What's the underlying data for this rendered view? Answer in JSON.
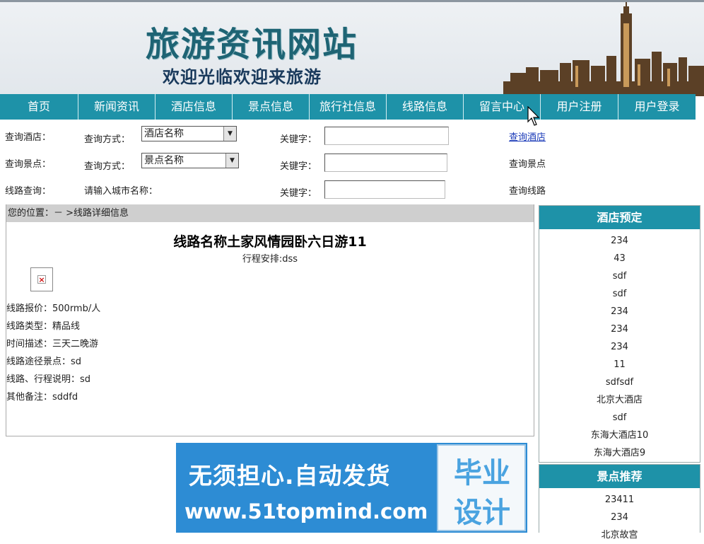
{
  "header": {
    "site_title": "旅游资讯网站",
    "subtitle": "欢迎光临欢迎来旅游"
  },
  "nav": {
    "items": [
      "首页",
      "新闻资讯",
      "酒店信息",
      "景点信息",
      "旅行社信息",
      "线路信息",
      "留言中心",
      "用户注册",
      "用户登录"
    ]
  },
  "search": {
    "hotel": {
      "label": "查询酒店：",
      "method_label": "查询方式：",
      "select_value": "酒店名称",
      "keyword_label": "关键字：",
      "button": "查询酒店"
    },
    "spot": {
      "label": "查询景点：",
      "method_label": "查询方式：",
      "select_value": "景点名称",
      "keyword_label": "关键字：",
      "button": "查询景点"
    },
    "route": {
      "label": "线路查询：",
      "hint": "请输入城市名称：",
      "keyword_label": "关键字：",
      "button": "查询线路"
    }
  },
  "content": {
    "breadcrumb": "您的位置：－ >线路详细信息",
    "route_title": "线路名称土家风情园卧六日游11",
    "schedule": "行程安排:dss",
    "details": [
      "线路报价：500rmb/人",
      "线路类型：精品线",
      "时间描述：三天二晚游",
      "线路途径景点：sd",
      "线路、行程说明：sd",
      "其他备注：sddfd"
    ]
  },
  "sidebar": {
    "hotel_title": "酒店预定",
    "hotels": [
      "234",
      "43",
      "sdf",
      "sdf",
      "234",
      "234",
      "234",
      "11",
      "sdfsdf",
      "北京大酒店",
      "sdf",
      "东海大酒店10",
      "东海大酒店9"
    ],
    "spot_title": "景点推荐",
    "spots": [
      "23411",
      "234",
      "北京故宫"
    ]
  },
  "ad": {
    "line1": "无须担心.自动发货",
    "line2": "www.51topmind.com",
    "badge1": "毕业",
    "badge2": "设计"
  },
  "colors": {
    "nav_bg": "#1e92a8",
    "title_teal": "#1e6474",
    "ad_blue": "#2d8cd4"
  }
}
